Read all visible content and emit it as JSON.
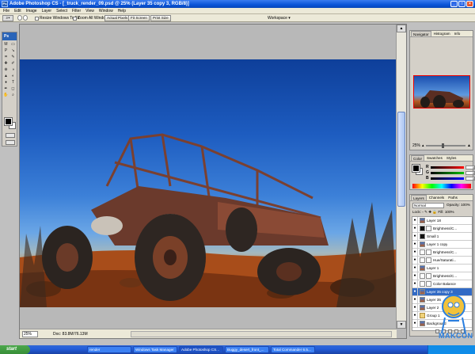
{
  "window": {
    "title": "Adobe Photoshop CS - [_truck_render_09.psd @ 25% (Layer 35 copy 3, RGB/8)]"
  },
  "menu": [
    "File",
    "Edit",
    "Image",
    "Layer",
    "Select",
    "Filter",
    "View",
    "Window",
    "Help"
  ],
  "options_bar": {
    "resize_label": "Resize Windows To Fit",
    "zoom_all_label": "Zoom All Windows",
    "actual_pixels": "Actual Pixels",
    "fit_screen": "Fit Screen",
    "print_size": "Print Size",
    "workspace": "Workspace ▾"
  },
  "toolbox": {
    "logo": "Ps",
    "tools": [
      "M",
      "▭",
      "P",
      "↘",
      "⌗",
      "✎",
      "✚",
      "✐",
      "⊕",
      "◑",
      "▲",
      "◐",
      "♦",
      "T",
      "✒",
      "◻",
      "✋",
      "⌕"
    ]
  },
  "document": {
    "zoom": "25%",
    "doc_info": "Doc: 83.8M/76.13M",
    "scroll_up": "▲",
    "scroll_down": "▼"
  },
  "navigator": {
    "tabs": [
      "Navigator",
      "Histogram",
      "Info"
    ],
    "zoom": "25%"
  },
  "color": {
    "tabs": [
      "Color",
      "Swatches",
      "Styles"
    ],
    "channels": [
      {
        "label": "R",
        "value": "0",
        "color": "#ff0000"
      },
      {
        "label": "G",
        "value": "0",
        "color": "#00c000"
      },
      {
        "label": "B",
        "value": "0",
        "color": "#0000ff"
      }
    ]
  },
  "layers": {
    "tabs": [
      "Layers",
      "Channels",
      "Paths"
    ],
    "blend_mode": "Normal",
    "opacity": "Opacity: 100%",
    "lock": "Lock:  ▫ ✎ ✚ 🔒  Fill: 100%",
    "rows": [
      {
        "name": "Layer 18",
        "thumb": "photo",
        "mask": false,
        "selected": false
      },
      {
        "name": "Brightness/C...",
        "thumb": "dark",
        "mask": true,
        "selected": false
      },
      {
        "name": "Small 1",
        "thumb": "dark",
        "mask": false,
        "selected": false
      },
      {
        "name": "Layer 1 copy",
        "thumb": "photo",
        "mask": false,
        "selected": false
      },
      {
        "name": "Brightness/C...",
        "thumb": "plain",
        "mask": true,
        "selected": false
      },
      {
        "name": "Hue/Saturati...",
        "thumb": "plain",
        "mask": true,
        "selected": false
      },
      {
        "name": "Layer 1",
        "thumb": "photo",
        "mask": false,
        "selected": false
      },
      {
        "name": "Brightness/C...",
        "thumb": "plain",
        "mask": true,
        "selected": false
      },
      {
        "name": "Color Balance",
        "thumb": "plain",
        "mask": true,
        "selected": false
      },
      {
        "name": "Layer 35 copy 3",
        "thumb": "photo",
        "mask": false,
        "selected": true
      },
      {
        "name": "Layer 35",
        "thumb": "photo",
        "mask": false,
        "selected": false
      },
      {
        "name": "Layer 2",
        "thumb": "photo",
        "mask": false,
        "selected": false
      },
      {
        "name": "Group 1",
        "thumb": "folder",
        "mask": false,
        "selected": false
      },
      {
        "name": "Background",
        "thumb": "photo",
        "mask": false,
        "selected": false
      }
    ]
  },
  "taskbar": {
    "start": "start",
    "tasks": [
      "render",
      "Windows Task Manager",
      "Adobe Photoshop CS...",
      "Buggy_desert_front_...",
      "Total Commander 6.5..."
    ]
  },
  "watermark": {
    "text": "MAKCON"
  },
  "colors": {
    "titlebar": "#0a54d8",
    "selection": "#316ac5",
    "sky_top": "#0e3f9a",
    "desert": "#b05a22"
  }
}
